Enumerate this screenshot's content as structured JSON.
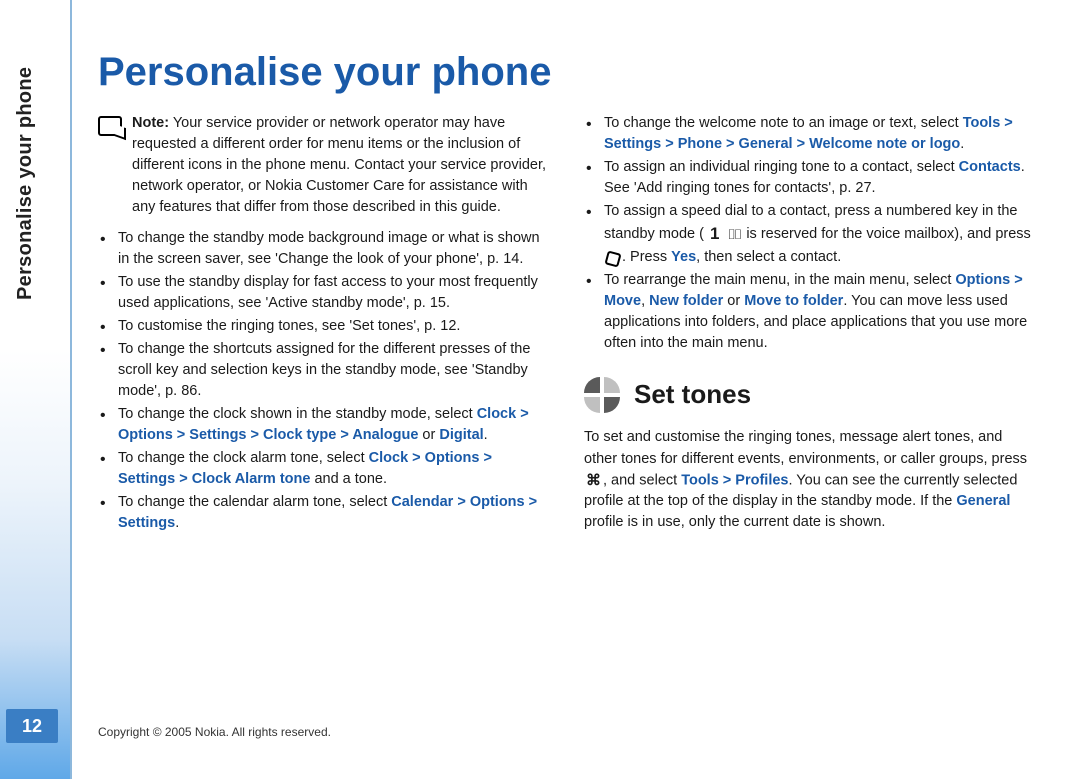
{
  "sideTab": "Personalise your phone",
  "pageNumber": "12",
  "title": "Personalise your phone",
  "note": {
    "label": "Note:",
    "text": " Your service provider or network operator may have requested a different order for menu items or the inclusion of different icons in the phone menu. Contact your service provider, network operator, or Nokia Customer Care for assistance with any features that differ from those described in this guide."
  },
  "leftBullets": [
    {
      "pre": "To change the standby mode background image or what is shown in the screen saver, see 'Change the look of your phone', p. 14."
    },
    {
      "pre": "To use the standby display for fast access to your most frequently used applications, see 'Active standby mode', p. 15."
    },
    {
      "pre": "To customise the ringing tones, see 'Set tones', p. 12."
    },
    {
      "pre": "To change the shortcuts assigned for the different presses of the scroll key and selection keys in the standby mode, see 'Standby mode', p. 86."
    },
    {
      "pre": "To change the clock shown in the standby mode, select ",
      "menu": "Clock > Options > Settings > Clock type > Analogue",
      "mid": " or ",
      "menu2": "Digital",
      "post": "."
    },
    {
      "pre": "To change the clock alarm tone, select ",
      "menu": "Clock > Options > Settings > Clock Alarm tone",
      "post": " and a tone."
    },
    {
      "pre": "To change the calendar alarm tone, select ",
      "menu": "Calendar > Options > Settings",
      "post": "."
    }
  ],
  "rightBullets": [
    {
      "pre": "To change the welcome note to an image or text, select ",
      "menu": "Tools > Settings > Phone > General > Welcome note or logo",
      "post": "."
    },
    {
      "pre": "To assign an individual ringing tone to a contact, select ",
      "menu": "Contacts",
      "post": ". See 'Add ringing tones for contacts', p. 27."
    },
    {
      "special": "speeddial"
    },
    {
      "pre": "To rearrange the main menu, in the main menu, select ",
      "menu": "Options > Move",
      "mid": ", ",
      "menu2": "New folder",
      "mid2": " or ",
      "menu3": "Move to folder",
      "post": ". You can move less used applications into folders, and place applications that you use more often into the main menu."
    }
  ],
  "speedDial": {
    "t1": "To assign a speed dial to a contact, press a numbered key in the standby mode ( ",
    "t2": " is reserved for the voice mailbox), and press ",
    "t3": ". Press ",
    "yes": "Yes",
    "t4": ", then select a contact."
  },
  "section2": "Set tones",
  "setTones": {
    "t1": "To set and customise the ringing tones, message alert tones, and other tones for different events, environments, or caller groups, press ",
    "t2": ", and select ",
    "menu": "Tools > Profiles",
    "t3": ". You can see the currently selected profile at the top of the display in the standby mode. If the ",
    "general": "General",
    "t4": " profile is in use, only the current date is shown."
  },
  "footer": "Copyright © 2005 Nokia. All rights reserved."
}
